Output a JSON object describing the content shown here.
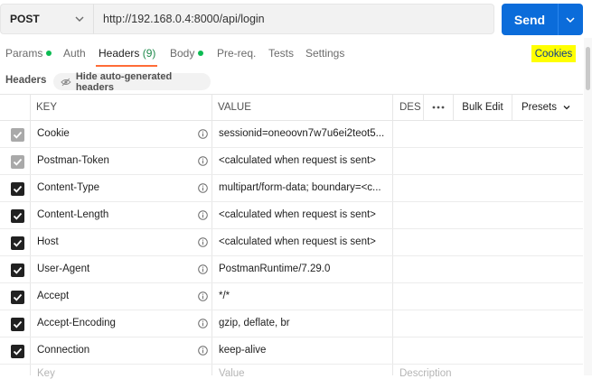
{
  "request": {
    "method": "POST",
    "url": "http://192.168.0.4:8000/api/login",
    "send_label": "Send"
  },
  "tabs": [
    {
      "label": "Params",
      "dot": true
    },
    {
      "label": "Auth"
    },
    {
      "label": "Headers",
      "count": "(9)",
      "active": true
    },
    {
      "label": "Body",
      "dot": true
    },
    {
      "label": "Pre-req."
    },
    {
      "label": "Tests"
    },
    {
      "label": "Settings"
    }
  ],
  "cookies_label": "Cookies",
  "headers_section": {
    "title": "Headers",
    "hide_button": "Hide auto-generated headers"
  },
  "table": {
    "columns": {
      "key": "KEY",
      "value": "VALUE",
      "description": "DESCRIPTION"
    },
    "bulk_edit": "Bulk Edit",
    "presets": "Presets",
    "rows": [
      {
        "key": "Cookie",
        "value": "sessionid=oneoovn7w7u6ei2teot5...",
        "checked": "dim"
      },
      {
        "key": "Postman-Token",
        "value": "<calculated when request is sent>",
        "checked": "dim"
      },
      {
        "key": "Content-Type",
        "value": "multipart/form-data; boundary=<c...",
        "checked": "on"
      },
      {
        "key": "Content-Length",
        "value": "<calculated when request is sent>",
        "checked": "on"
      },
      {
        "key": "Host",
        "value": "<calculated when request is sent>",
        "checked": "on"
      },
      {
        "key": "User-Agent",
        "value": "PostmanRuntime/7.29.0",
        "checked": "on"
      },
      {
        "key": "Accept",
        "value": "*/*",
        "checked": "on"
      },
      {
        "key": "Accept-Encoding",
        "value": "gzip, deflate, br",
        "checked": "on"
      },
      {
        "key": "Connection",
        "value": "keep-alive",
        "checked": "on"
      }
    ],
    "new_row": {
      "key": "Key",
      "value": "Value",
      "description": "Description"
    }
  },
  "colors": {
    "send": "#0b6cda",
    "active_tab_underline": "#ff6c37",
    "status_dot": "#0cbb52",
    "highlight": "#ffff00"
  }
}
